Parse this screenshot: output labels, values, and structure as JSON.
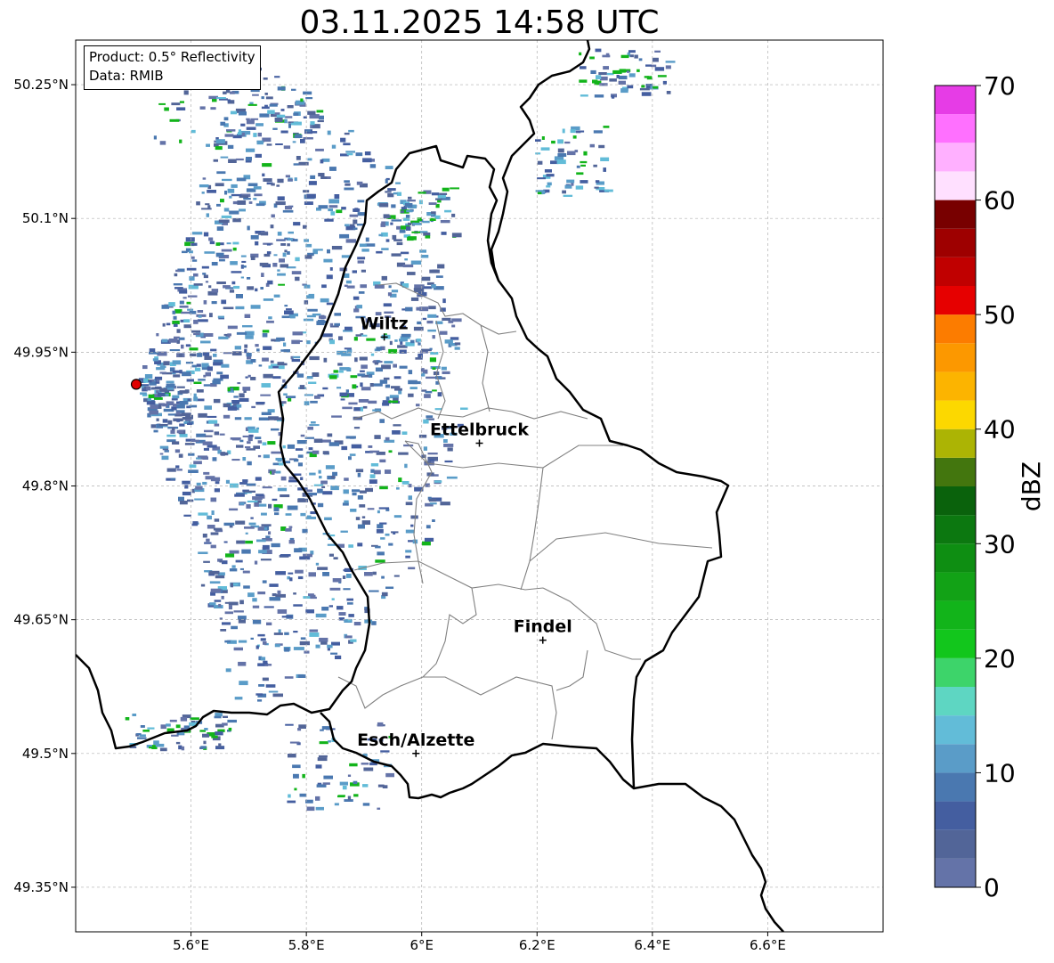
{
  "title": "03.11.2025 14:58 UTC",
  "info": {
    "product": "Product: 0.5° Reflectivity",
    "data": "Data: RMIB"
  },
  "map": {
    "lon_range": [
      5.4,
      6.8
    ],
    "lat_range": [
      49.3,
      50.3
    ],
    "x_ticks": [
      {
        "value": 5.6,
        "label": "5.6°E"
      },
      {
        "value": 5.8,
        "label": "5.8°E"
      },
      {
        "value": 6.0,
        "label": "6°E"
      },
      {
        "value": 6.2,
        "label": "6.2°E"
      },
      {
        "value": 6.4,
        "label": "6.4°E"
      },
      {
        "value": 6.6,
        "label": "6.6°E"
      }
    ],
    "y_ticks": [
      {
        "value": 49.35,
        "label": "49.35°N"
      },
      {
        "value": 49.5,
        "label": "49.5°N"
      },
      {
        "value": 49.65,
        "label": "49.65°N"
      },
      {
        "value": 49.8,
        "label": "49.8°N"
      },
      {
        "value": 49.95,
        "label": "49.95°N"
      },
      {
        "value": 50.1,
        "label": "50.1°N"
      },
      {
        "value": 50.25,
        "label": "50.25°N"
      }
    ],
    "grid": true,
    "radar_site": {
      "lon": 5.505,
      "lat": 49.914,
      "color": "#e00000"
    },
    "cities": [
      {
        "name": "Wiltz",
        "lon": 5.935,
        "lat": 49.967
      },
      {
        "name": "Ettelbruck",
        "lon": 6.1,
        "lat": 49.848
      },
      {
        "name": "Findel",
        "lon": 6.21,
        "lat": 49.627
      },
      {
        "name": "Esch/Alzette",
        "lon": 5.99,
        "lat": 49.5
      }
    ]
  },
  "colorbar": {
    "label": "dBZ",
    "min": 0,
    "max": 70,
    "step": 2.5,
    "ticks": [
      {
        "value": 0,
        "label": "0"
      },
      {
        "value": 10,
        "label": "10"
      },
      {
        "value": 20,
        "label": "20"
      },
      {
        "value": 30,
        "label": "30"
      },
      {
        "value": 40,
        "label": "40"
      },
      {
        "value": 50,
        "label": "50"
      },
      {
        "value": 60,
        "label": "60"
      },
      {
        "value": 70,
        "label": "70"
      }
    ],
    "colors": [
      "#6473a8",
      "#526598",
      "#445ea0",
      "#4a78b0",
      "#5a9cc8",
      "#62bcd8",
      "#5ed6c2",
      "#3dd46a",
      "#12c61c",
      "#12b41a",
      "#12a216",
      "#0e8e12",
      "#0c7810",
      "#0a620c",
      "#43760e",
      "#acb404",
      "#fcd800",
      "#fcb400",
      "#fc9800",
      "#fc7c00",
      "#e60000",
      "#c00000",
      "#9e0000",
      "#780000",
      "#ffe0ff",
      "#ffb0ff",
      "#ff70ff",
      "#e63ce6"
    ]
  }
}
